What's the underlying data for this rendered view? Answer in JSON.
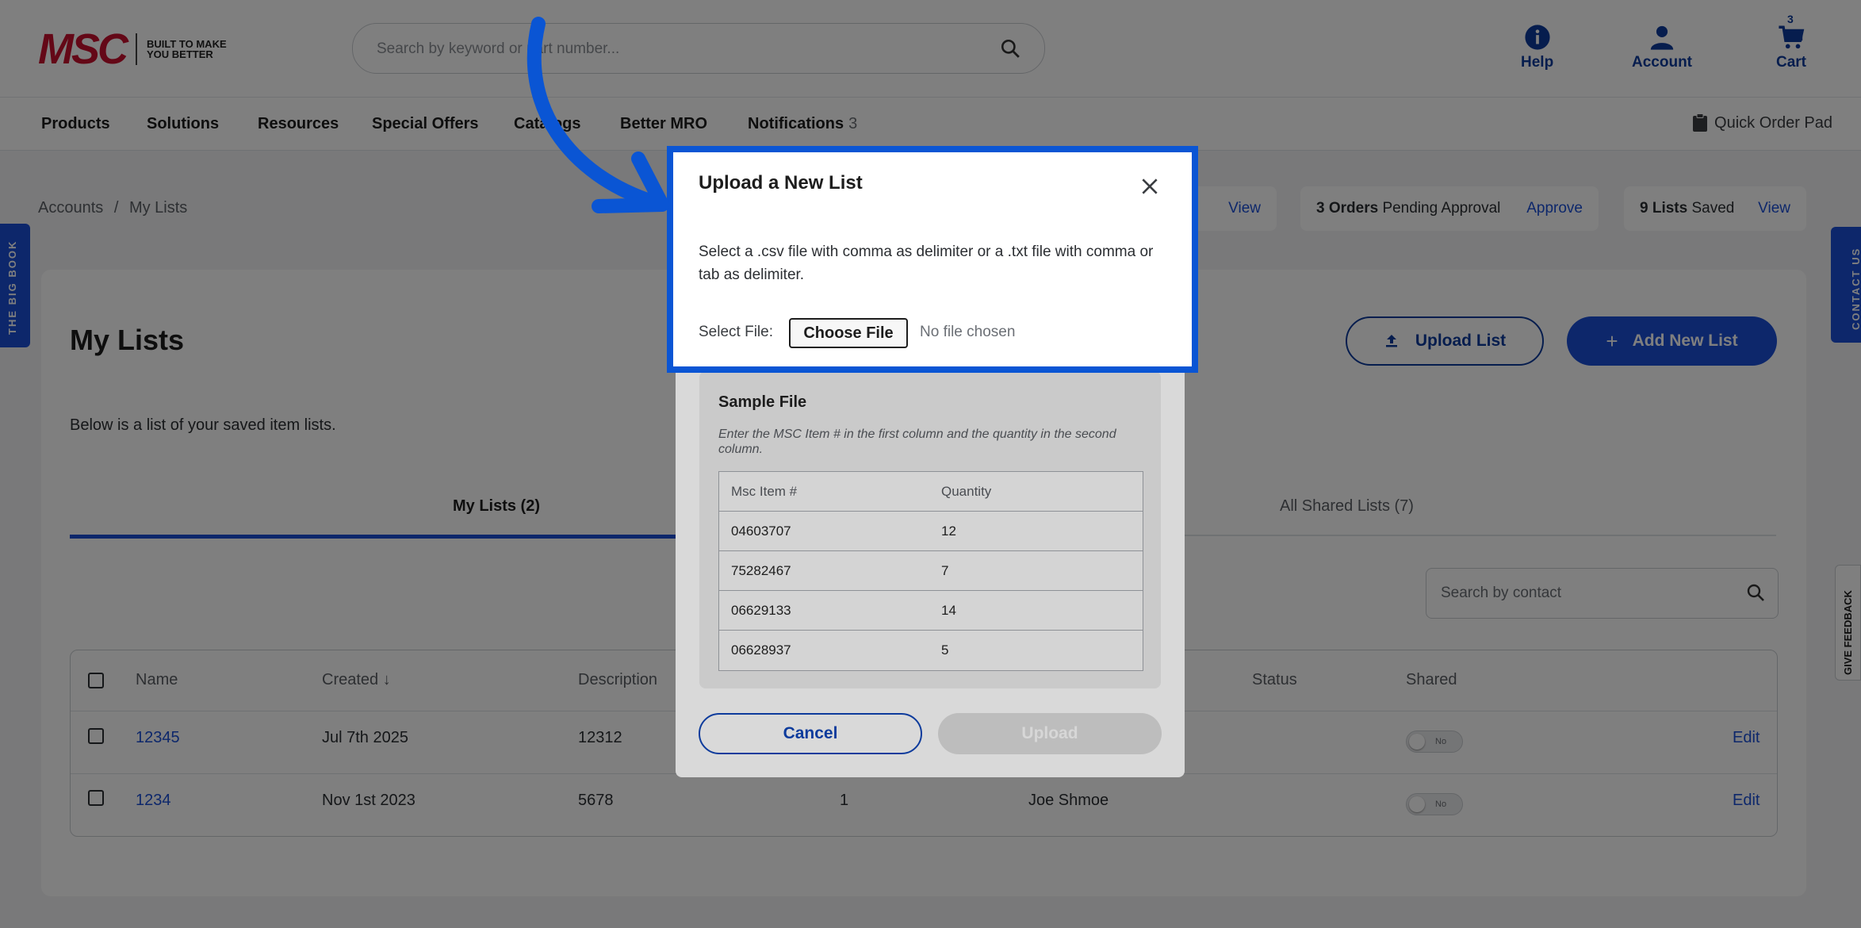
{
  "header": {
    "logo_text": "MSC",
    "logo_tagline": "BUILT TO MAKE YOU BETTER",
    "search_placeholder": "Search by keyword or part number...",
    "help_label": "Help",
    "account_label": "Account",
    "cart_label": "Cart",
    "cart_count": "3"
  },
  "nav": {
    "items": [
      "Products",
      "Solutions",
      "Resources",
      "Special Offers",
      "Catalogs",
      "Better MRO",
      "Notifications"
    ],
    "notifications_count": "3",
    "quick_order": "Quick Order Pad"
  },
  "breadcrumbs": {
    "root": "Accounts",
    "separator": "/",
    "current": "My Lists"
  },
  "stats": [
    {
      "strong": "",
      "text": "",
      "link": "View"
    },
    {
      "strong": "3 Orders",
      "text": "Pending Approval",
      "link": "Approve"
    },
    {
      "strong": "9 Lists",
      "text": "Saved",
      "link": "View"
    }
  ],
  "side_tabs": {
    "big_book": "THE BIG BOOK",
    "contact_us": "CONTACT US",
    "feedback": "GIVE FEEDBACK"
  },
  "page": {
    "title": "My Lists",
    "intro": "Below is a list of your saved item lists.",
    "upload_button": "Upload List",
    "add_button": "Add New List",
    "tab_mine": "My Lists (2)",
    "tab_shared": "All Shared Lists (7)",
    "contact_search_placeholder": "Search by contact"
  },
  "table": {
    "headers": {
      "name": "Name",
      "created": "Created ↓",
      "description": "Description",
      "status": "Status",
      "shared": "Shared"
    },
    "rows": [
      {
        "name": "12345",
        "created": "Jul 7th 2025",
        "description": "12312",
        "items": "",
        "owner": "",
        "shared": "No",
        "action": "Edit"
      },
      {
        "name": "1234",
        "created": "Nov 1st 2023",
        "description": "5678",
        "items": "1",
        "owner": "Joe Shmoe",
        "shared": "No",
        "action": "Edit"
      }
    ]
  },
  "modal": {
    "title": "Upload a New List",
    "description": "Select a .csv file with comma as delimiter or a .txt file with comma or tab as delimiter.",
    "select_label": "Select File:",
    "choose_button": "Choose File",
    "no_file": "No file chosen",
    "sample_title": "Sample File",
    "sample_note": "Enter the MSC Item # in the first column and the quantity in the second column.",
    "sample_headers": [
      "Msc Item #",
      "Quantity"
    ],
    "sample_rows": [
      [
        "04603707",
        "12"
      ],
      [
        "75282467",
        "7"
      ],
      [
        "06629133",
        "14"
      ],
      [
        "06628937",
        "5"
      ]
    ],
    "cancel": "Cancel",
    "upload": "Upload"
  },
  "colors": {
    "brand_blue": "#1a4fd6",
    "dark_blue": "#0d3b9c",
    "highlight": "#0a55d4",
    "logo_red": "#c8102e"
  }
}
